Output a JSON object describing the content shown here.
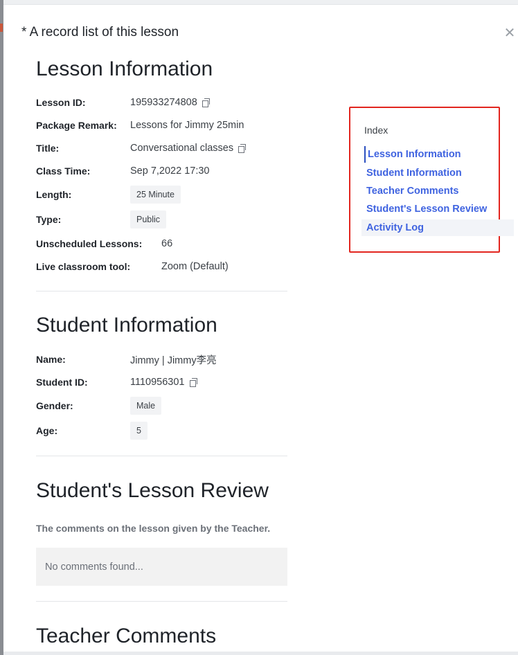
{
  "drawer": {
    "title": "* A record list of this lesson",
    "close_glyph": "✕"
  },
  "lesson_info": {
    "heading": "Lesson Information",
    "fields": [
      {
        "label": "Lesson ID:",
        "value": "195933274808"
      },
      {
        "label": "Package Remark:",
        "value": "Lessons for Jimmy 25min"
      },
      {
        "label": "Title:",
        "value": "Conversational classes"
      },
      {
        "label": "Class Time:",
        "value": "Sep 7,2022 17:30"
      },
      {
        "label": "Length:",
        "value": "25 Minute"
      },
      {
        "label": "Type:",
        "value": "Public"
      },
      {
        "label": "Unscheduled Lessons:",
        "value": "66"
      },
      {
        "label": "Live classroom tool:",
        "value": "Zoom (Default)"
      }
    ]
  },
  "student_info": {
    "heading": "Student Information",
    "fields": [
      {
        "label": "Name:",
        "value": "Jimmy | Jimmy李亮"
      },
      {
        "label": "Student ID:",
        "value": "1110956301"
      },
      {
        "label": "Gender:",
        "value": "Male"
      },
      {
        "label": "Age:",
        "value": "5"
      }
    ]
  },
  "lesson_review": {
    "heading": "Student's Lesson Review",
    "description": "The comments on the lesson given by the Teacher.",
    "empty_text": "No comments found..."
  },
  "teacher_comments": {
    "heading": "Teacher Comments"
  },
  "index": {
    "title": "Index",
    "items": [
      {
        "label": "Lesson Information"
      },
      {
        "label": "Student Information"
      },
      {
        "label": "Teacher Comments"
      },
      {
        "label": "Student's Lesson Review"
      },
      {
        "label": "Activity Log"
      }
    ]
  },
  "colors": {
    "link": "#3f63e0",
    "highlight_border": "#e2261f",
    "tag_bg": "#f2f3f5"
  }
}
